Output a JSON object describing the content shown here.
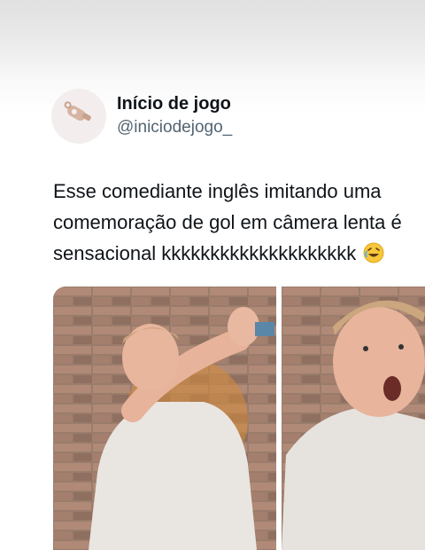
{
  "tweet": {
    "display_name": "Início de jogo",
    "handle": "@iniciodejogo_",
    "text_lines": [
      "Esse comediante inglês imitando uma",
      "comemoração de gol em câmera lenta é",
      "sensacional kkkkkkkkkkkkkkkkkkkk"
    ],
    "emoji": "rolling-on-floor-laughing",
    "avatar_icon": "whistle-icon",
    "media": [
      {
        "kind": "photo",
        "description_icon": "photo-frame"
      },
      {
        "kind": "photo",
        "description_icon": "photo-frame"
      }
    ]
  },
  "colors": {
    "text_primary": "#0f1419",
    "text_secondary": "#536471",
    "avatar_bg": "#f3eeed",
    "whistle": "#c9a28d"
  }
}
